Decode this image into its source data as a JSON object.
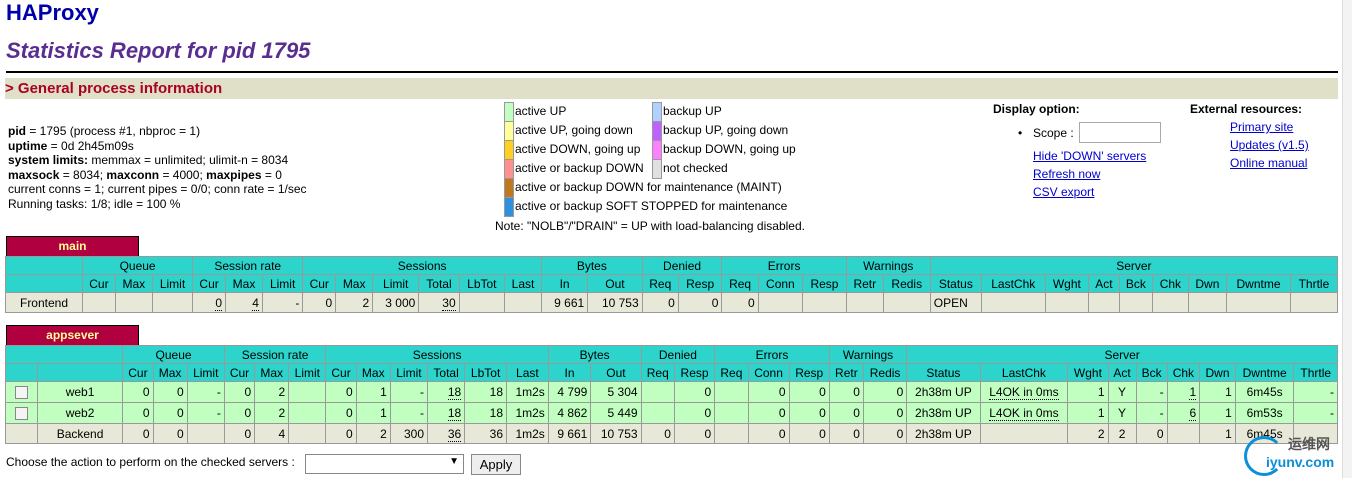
{
  "app_title": "HAProxy",
  "report_title": "Statistics Report for pid 1795",
  "section_general": "> General process information",
  "process": {
    "l1_key": "pid",
    "l1_val": " = 1795 (process #1, nbproc = 1)",
    "l2_key": "uptime",
    "l2_val": " = 0d 2h45m09s",
    "l3_key": "system limits:",
    "l3_val": " memmax = unlimited; ulimit-n = 8034",
    "l4_key1": "maxsock",
    "l4_val1": " = 8034; ",
    "l4_key2": "maxconn",
    "l4_val2": " = 4000; ",
    "l4_key3": "maxpipes",
    "l4_val3": " = 0",
    "l5": "current conns = 1; current pipes = 0/0; conn rate = 1/sec",
    "l6": "Running tasks: 1/8; idle = 100 %"
  },
  "legend": {
    "left": [
      {
        "label": "active UP",
        "color": "#c0ffc0"
      },
      {
        "label": "active UP, going down",
        "color": "#ffffa0"
      },
      {
        "label": "active DOWN, going up",
        "color": "#ffd020"
      },
      {
        "label": "active or backup DOWN",
        "color": "#ff9090"
      },
      {
        "label": "active or backup DOWN for maintenance (MAINT)",
        "color": "#c07820"
      },
      {
        "label": "active or backup SOFT STOPPED for maintenance",
        "color": "#3090e0"
      }
    ],
    "right": [
      {
        "label": "backup UP",
        "color": "#b0d0ff"
      },
      {
        "label": "backup UP, going down",
        "color": "#c060ff"
      },
      {
        "label": "backup DOWN, going up",
        "color": "#ff80ff"
      },
      {
        "label": "not checked",
        "color": "#e0e0e0"
      }
    ],
    "note": "Note: \"NOLB\"/\"DRAIN\" = UP with load-balancing disabled."
  },
  "display_option": {
    "title": "Display option:",
    "scope_label": "Scope :",
    "links": [
      "Hide 'DOWN' servers",
      "Refresh now",
      "CSV export"
    ]
  },
  "external": {
    "title": "External resources:",
    "links": [
      "Primary site",
      "Updates (v1.5)",
      "Online manual"
    ]
  },
  "main_proxy": {
    "name": "main",
    "groups": [
      "",
      "Queue",
      "Session rate",
      "Sessions",
      "Bytes",
      "Denied",
      "Errors",
      "Warnings",
      "Server"
    ],
    "cols": [
      "",
      "Cur",
      "Max",
      "Limit",
      "Cur",
      "Max",
      "Limit",
      "Cur",
      "Max",
      "Limit",
      "Total",
      "LbTot",
      "Last",
      "In",
      "Out",
      "Req",
      "Resp",
      "Req",
      "Conn",
      "Resp",
      "Retr",
      "Redis",
      "Status",
      "LastChk",
      "Wght",
      "Act",
      "Bck",
      "Chk",
      "Dwn",
      "Dwntme",
      "Thrtle"
    ],
    "frontend": [
      "Frontend",
      "",
      "",
      "",
      "0",
      "4",
      "-",
      "0",
      "2",
      "3 000",
      "30",
      "",
      "",
      "9 661",
      "10 753",
      "0",
      "0",
      "0",
      "",
      "",
      "",
      "",
      "OPEN",
      "",
      "",
      "",
      "",
      "",
      "",
      "",
      ""
    ]
  },
  "app_proxy": {
    "name": "appsever",
    "groups": [
      "",
      "Queue",
      "Session rate",
      "Sessions",
      "Bytes",
      "Denied",
      "Errors",
      "Warnings",
      "Server"
    ],
    "cols": [
      "",
      "",
      "Cur",
      "Max",
      "Limit",
      "Cur",
      "Max",
      "Limit",
      "Cur",
      "Max",
      "Limit",
      "Total",
      "LbTot",
      "Last",
      "In",
      "Out",
      "Req",
      "Resp",
      "Req",
      "Conn",
      "Resp",
      "Retr",
      "Redis",
      "Status",
      "LastChk",
      "Wght",
      "Act",
      "Bck",
      "Chk",
      "Dwn",
      "Dwntme",
      "Thrtle"
    ],
    "rows": [
      [
        "web1",
        "0",
        "0",
        "-",
        "0",
        "2",
        "",
        "0",
        "1",
        "-",
        "18",
        "18",
        "1m2s",
        "4 799",
        "5 304",
        "",
        "0",
        "",
        "0",
        "0",
        "0",
        "0",
        "2h38m UP",
        "L4OK in 0ms",
        "1",
        "Y",
        "-",
        "1",
        "1",
        "6m45s",
        "-"
      ],
      [
        "web2",
        "0",
        "0",
        "-",
        "0",
        "2",
        "",
        "0",
        "1",
        "-",
        "18",
        "18",
        "1m2s",
        "4 862",
        "5 449",
        "",
        "0",
        "",
        "0",
        "0",
        "0",
        "0",
        "2h38m UP",
        "L4OK in 0ms",
        "1",
        "Y",
        "-",
        "6",
        "1",
        "6m53s",
        "-"
      ],
      [
        "Backend",
        "0",
        "0",
        "",
        "0",
        "4",
        "",
        "0",
        "2",
        "300",
        "36",
        "36",
        "1m2s",
        "9 661",
        "10 753",
        "0",
        "0",
        "",
        "0",
        "0",
        "0",
        "0",
        "2h38m UP",
        "",
        "2",
        "2",
        "0",
        "",
        "1",
        "6m45s",
        ""
      ]
    ]
  },
  "action": {
    "label": "Choose the action to perform on the checked servers :",
    "apply": "Apply"
  },
  "watermark": {
    "t1": "运维网",
    "t2": "iyunv.com"
  }
}
